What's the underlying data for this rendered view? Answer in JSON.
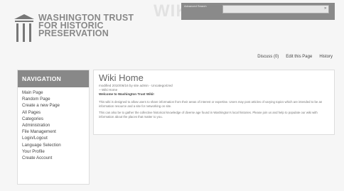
{
  "logo": {
    "line1": "WASHINGTON TRUST",
    "line2": "FOR HISTORIC",
    "line3": "PRESERVATION"
  },
  "wiki_word": "WIKI",
  "search": {
    "label": "Advanced Search",
    "placeholder": "",
    "go": "»"
  },
  "page_actions": {
    "discuss": "Discuss (0)",
    "edit": "Edit this Page",
    "history": "History"
  },
  "navigation": {
    "title": "NAVIGATION",
    "items": [
      "Main Page",
      "Random Page",
      "Create a new Page",
      "All Pages",
      "Categories",
      "Administration",
      "File Management",
      "Login/Logout",
      "Language Selection",
      "Your Profile",
      "Create Account"
    ]
  },
  "main": {
    "title": "Wiki Home",
    "modified": "modified 2010/06/16 by site admin - Uncategorized",
    "breadcrumb": "~ Wiki Home",
    "welcome": "Welcome to Washington Trust Wiki!",
    "paragraph1": "This wiki is designed to allow users to share information from their areas of interest or expertise. Users may post articles of varying topics which are intended to be an information resource and a site for networking on site.",
    "paragraph2": "This can also be to gather the collective historical knowledge of diverse age found in Washington's local histories. Please join us and help to populate our wiki with information about the places that matter to you."
  }
}
